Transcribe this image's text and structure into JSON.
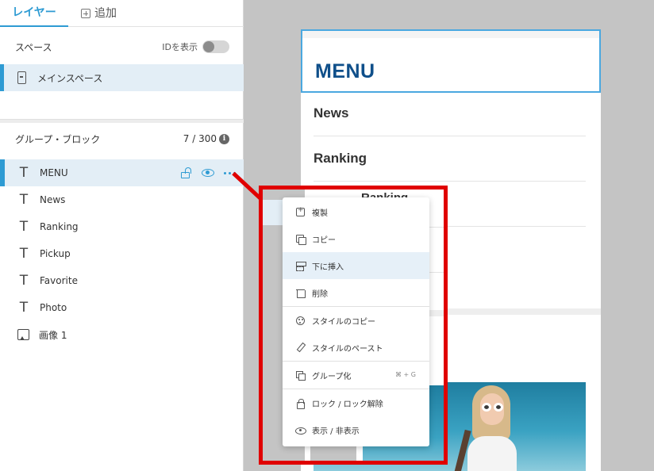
{
  "tabs": {
    "layers": "レイヤー",
    "add": "追加"
  },
  "space": {
    "heading": "スペース",
    "show_id_label": "IDを表示",
    "main_space": "メインスペース"
  },
  "group": {
    "heading": "グループ・ブロック",
    "count": "7 / 300",
    "info_glyph": "i"
  },
  "layers": [
    {
      "label": "MENU",
      "type": "text",
      "selected": true
    },
    {
      "label": "News",
      "type": "text"
    },
    {
      "label": "Ranking",
      "type": "text"
    },
    {
      "label": "Pickup",
      "type": "text"
    },
    {
      "label": "Favorite",
      "type": "text"
    },
    {
      "label": "Photo",
      "type": "text"
    },
    {
      "label": "画像 1",
      "type": "image"
    }
  ],
  "text_glyph": "T",
  "preview": {
    "menu_title": "MENU",
    "items": [
      "News",
      "Ranking"
    ],
    "partial_item": "Ranking"
  },
  "context_menu": {
    "duplicate": "複製",
    "copy": "コピー",
    "insert_below": "下に挿入",
    "delete": "削除",
    "copy_style": "スタイルのコピー",
    "paste_style": "スタイルのペースト",
    "group": "グループ化",
    "group_shortcut": "⌘ + G",
    "lock_unlock": "ロック / ロック解除",
    "show_hide": "表示 / 非表示"
  },
  "colors": {
    "accent": "#2e9bd3",
    "menu_title": "#0f4f8a",
    "highlight_red": "#e00000",
    "selected_bg": "#e3eef6"
  }
}
